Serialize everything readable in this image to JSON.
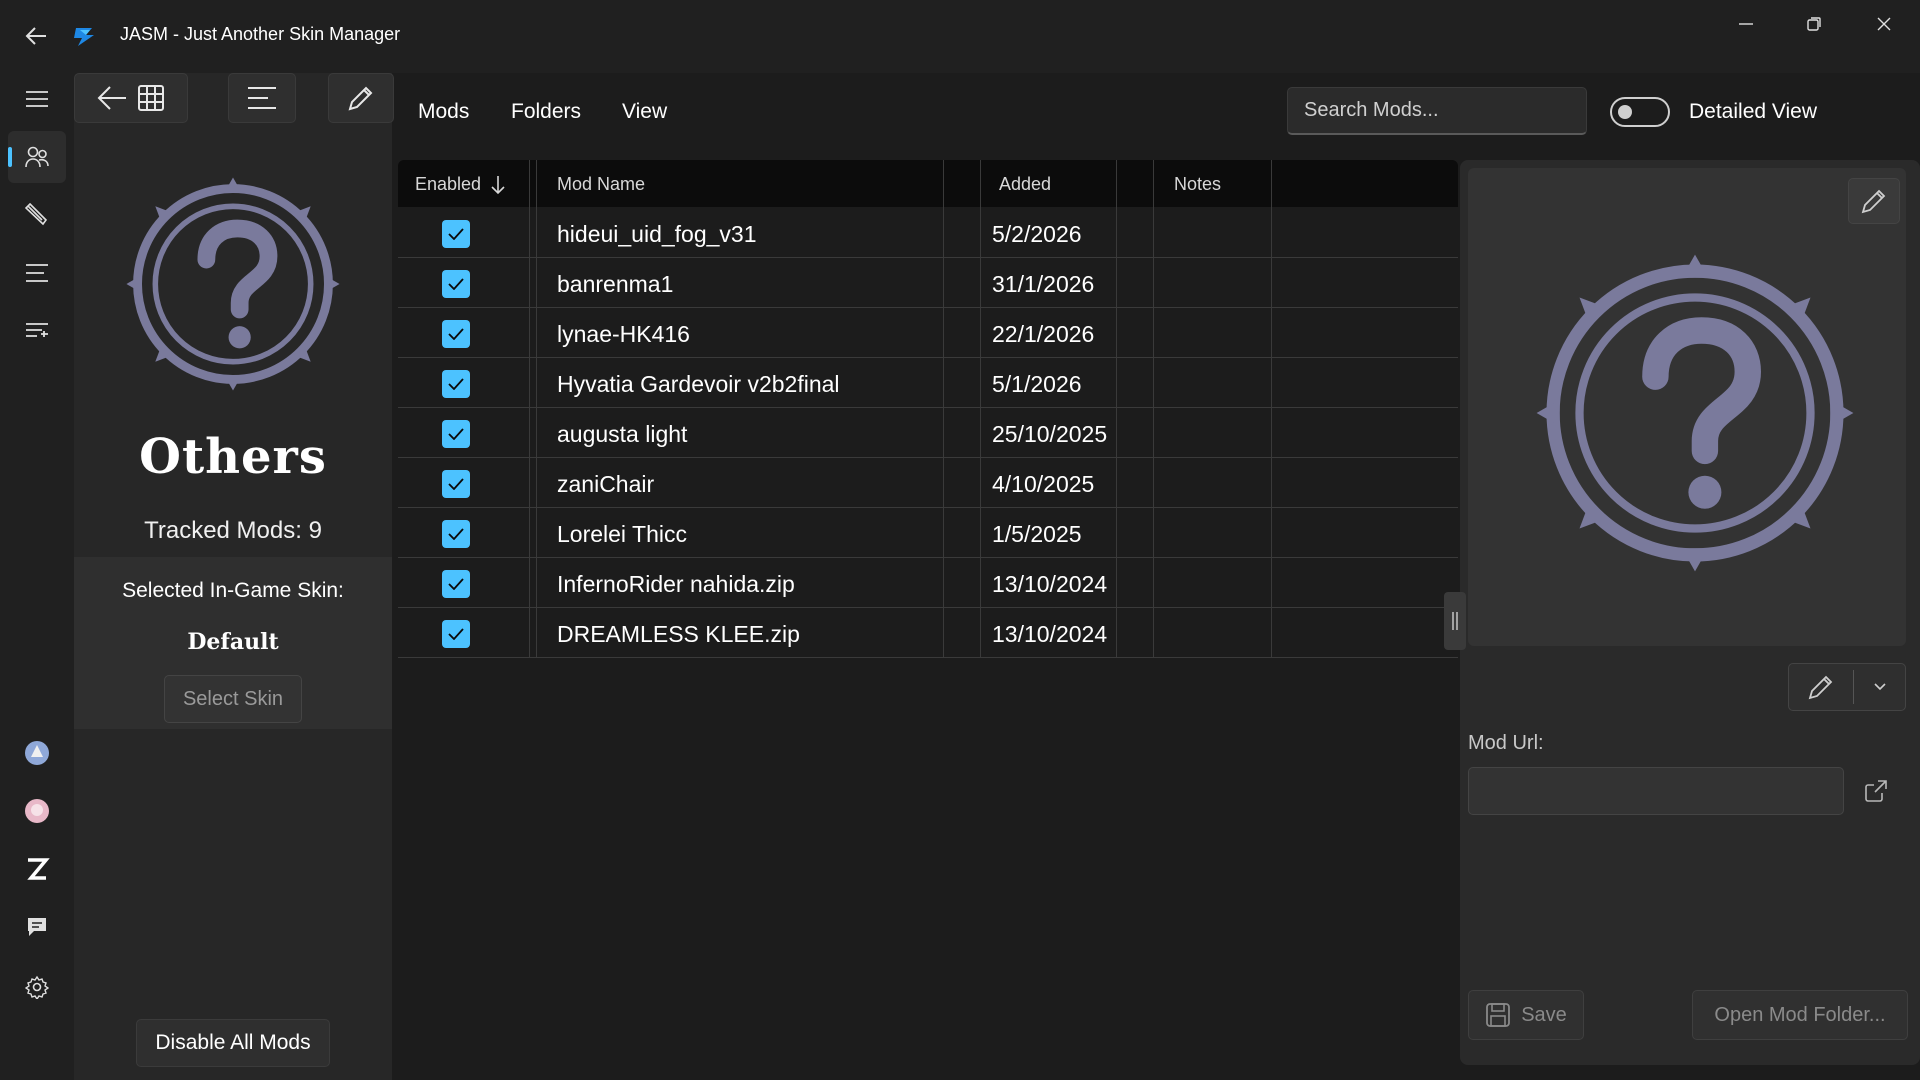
{
  "window": {
    "title": "JASM - Just Another Skin Manager"
  },
  "nav": {
    "items": [
      "menu-icon",
      "characters-icon",
      "brush-icon",
      "list-icon",
      "filter-list-icon",
      "game-genshin-icon",
      "game-starrail-icon",
      "game-zzz-icon",
      "feedback-icon",
      "settings-icon"
    ]
  },
  "category": {
    "title": "Others",
    "tracked": "Tracked Mods: 9",
    "skin_label": "Selected In-Game Skin:",
    "skin_value": "Default",
    "select_skin": "Select Skin",
    "disable_all": "Disable All Mods"
  },
  "menu": {
    "mods": "Mods",
    "folders": "Folders",
    "view": "View"
  },
  "search": {
    "placeholder": "Search Mods..."
  },
  "toggle": {
    "label": "Detailed View",
    "on": false
  },
  "table": {
    "columns": {
      "enabled": "Enabled",
      "name": "Mod Name",
      "added": "Added",
      "notes": "Notes"
    },
    "rows": [
      {
        "enabled": true,
        "name": "hideui_uid_fog_v31",
        "added": "5/2/2026"
      },
      {
        "enabled": true,
        "name": "banrenma1",
        "added": "31/1/2026"
      },
      {
        "enabled": true,
        "name": "lynae-HK416",
        "added": "22/1/2026"
      },
      {
        "enabled": true,
        "name": "Hyvatia Gardevoir v2b2final",
        "added": "5/1/2026"
      },
      {
        "enabled": true,
        "name": "augusta light",
        "added": "25/10/2025"
      },
      {
        "enabled": true,
        "name": "zaniChair",
        "added": "4/10/2025"
      },
      {
        "enabled": true,
        "name": "Lorelei Thicc",
        "added": "1/5/2025"
      },
      {
        "enabled": true,
        "name": "InfernoRider nahida.zip",
        "added": "13/10/2024"
      },
      {
        "enabled": true,
        "name": "DREAMLESS KLEE.zip",
        "added": "13/10/2024"
      }
    ]
  },
  "detail": {
    "url_label": "Mod Url:",
    "url_value": "",
    "save": "Save",
    "open_folder": "Open Mod Folder..."
  },
  "colors": {
    "accent": "#4cc2ff",
    "background": "#202020",
    "pane": "#272727",
    "emblem": "#7a7a9c"
  }
}
